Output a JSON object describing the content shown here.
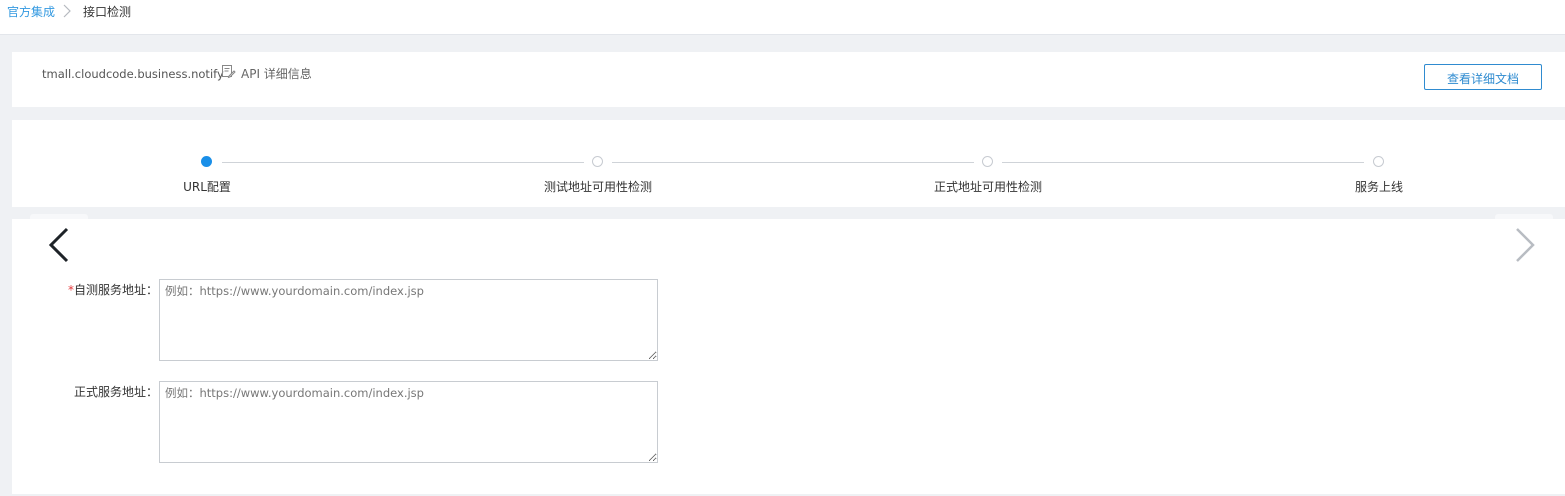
{
  "breadcrumb": {
    "parent": "官方集成",
    "current": "接口检测"
  },
  "api": {
    "name": "tmall.cloudcode.business.notify",
    "detail_link": "API 详细信息",
    "detail_icon": "edit-doc-icon",
    "doc_button": "查看详细文档"
  },
  "steps": [
    {
      "label": "URL配置",
      "active": true
    },
    {
      "label": "测试地址可用性检测",
      "active": false
    },
    {
      "label": "正式地址可用性检测",
      "active": false
    },
    {
      "label": "服务上线",
      "active": false
    }
  ],
  "form": {
    "test_url": {
      "required_mark": "*",
      "label": "自测服务地址：",
      "value": "",
      "placeholder": "例如：https://www.yourdomain.com/index.jsp"
    },
    "prod_url": {
      "label": "正式服务地址：",
      "value": "",
      "placeholder": "例如：https://www.yourdomain.com/index.jsp"
    }
  },
  "colors": {
    "accent": "#1a8fe8",
    "link": "#3399e0",
    "required": "#e4393c"
  }
}
